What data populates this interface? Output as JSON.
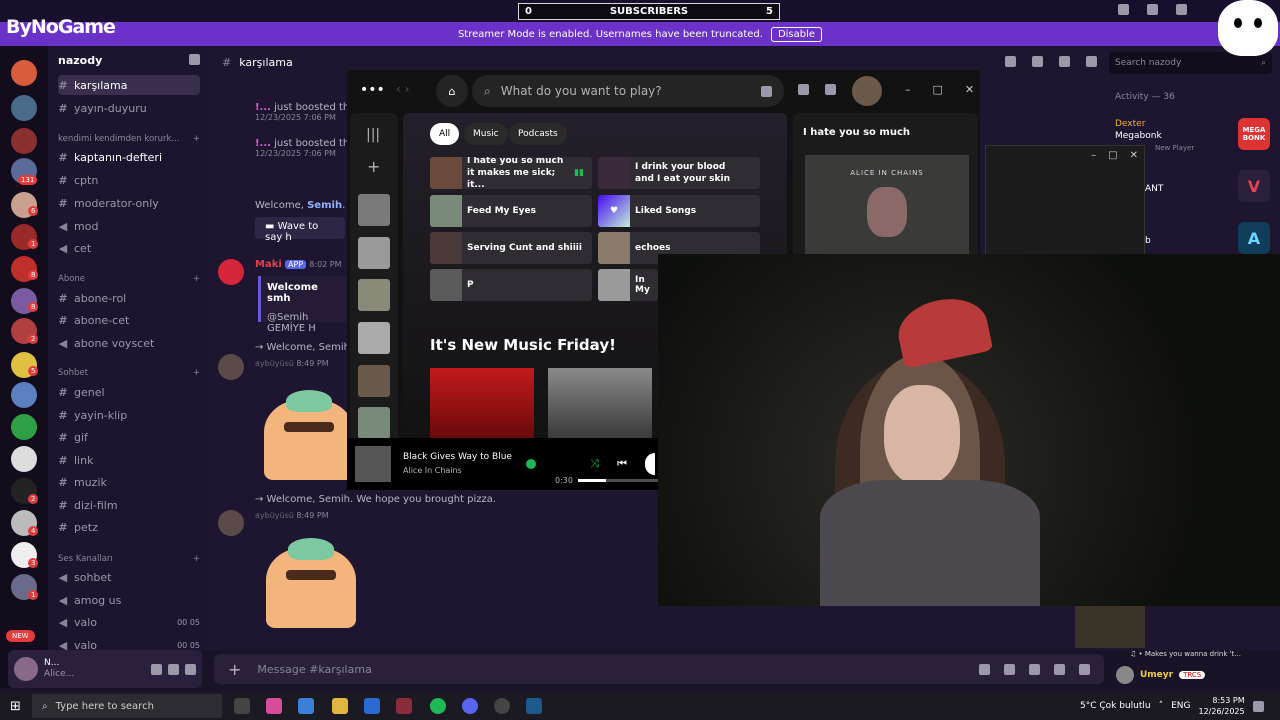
{
  "subs": {
    "left": "0",
    "label": "SUBSCRIBERS",
    "right": "5"
  },
  "banner": {
    "text": "Streamer Mode is enabled. Usernames have been truncated.",
    "button": "Disable"
  },
  "logo": "ByNoGame",
  "server": {
    "name": "nazody"
  },
  "channels": {
    "top": [
      {
        "label": "karşılama"
      },
      {
        "label": "yayın-duyuru"
      }
    ],
    "cat1": "kendimi kendimden korurk...",
    "list1": [
      {
        "label": "kaptanın-defteri"
      },
      {
        "label": "cptn"
      },
      {
        "label": "moderator-only"
      },
      {
        "label": "mod"
      },
      {
        "label": "cet"
      }
    ],
    "cat2": "Abone",
    "list2": [
      {
        "label": "abone-rol"
      },
      {
        "label": "abone-cet"
      },
      {
        "label": "abone voyscet"
      }
    ],
    "cat3": "Sohbet",
    "list3": [
      {
        "label": "genel"
      },
      {
        "label": "yayin-klip"
      },
      {
        "label": "gif"
      },
      {
        "label": "link"
      },
      {
        "label": "muzik"
      },
      {
        "label": "dizi-film"
      },
      {
        "label": "petz"
      }
    ],
    "cat4": "Ses Kanalları",
    "voice": [
      {
        "label": "sohbet"
      },
      {
        "label": "amog us"
      },
      {
        "label": "valo",
        "a": "00",
        "b": "05"
      },
      {
        "label": "valo",
        "a": "00",
        "b": "05"
      }
    ]
  },
  "user": {
    "name": "N...",
    "status": "Alice..."
  },
  "chat": {
    "channel": "karşılama",
    "m1": "just boosted the",
    "t1": "12/23/2025 7:06 PM",
    "m2": "just boosted the",
    "t2": "12/23/2025 7:06 PM",
    "welcome1a": "Welcome, ",
    "welcome1b": "Semih",
    "welcome1c": ". We",
    "wave": "Wave to say h",
    "maki": "Maki",
    "app": "APP",
    "maki_time": "8:02 PM",
    "embed_title": "Welcome smh",
    "embed_body": "@Semih GEMİYE H",
    "w2": "→ Welcome, Semih. We",
    "user2": "aybüyüsü",
    "time2": "8:49 PM",
    "w3": "→ Welcome, Semih. We hope you brought pizza.",
    "user3": "aybüyüsü",
    "time3": "8:49 PM",
    "placeholder": "Message #karşılama"
  },
  "spotify": {
    "search": "What do you want to play?",
    "chips": [
      "All",
      "Music",
      "Podcasts"
    ],
    "tiles": [
      {
        "l1": "I hate you so much",
        "l2": "it makes me sick; it..."
      },
      {
        "l1": "I drink your blood",
        "l2": "and I eat your skin"
      },
      {
        "l1": "Feed My Eyes",
        "l2": ""
      },
      {
        "l1": "Liked Songs",
        "l2": ""
      },
      {
        "l1": "Serving Cunt and shiiii",
        "l2": ""
      },
      {
        "l1": "echoes",
        "l2": ""
      },
      {
        "l1": "P",
        "l2": ""
      },
      {
        "l1": "In My",
        "l2": ""
      }
    ],
    "section": "It's New Music Friday!",
    "right_title": "I hate you so much",
    "right_art": "ALICE IN CHAINS",
    "now_title": "Black Gives Way to Blue",
    "now_artist": "Alice In Chains",
    "now_time": "0:30"
  },
  "right": {
    "search": "Search nazody",
    "activity": "Activity — 36",
    "a1": "Dexter",
    "a2": "Megabonk",
    "a3": "New Player",
    "a4": "ANT",
    "a5": "b",
    "gameicons": [
      {
        "label": "MEGA BONK",
        "color": "#d33"
      },
      {
        "label": "V",
        "color": "#e4424d"
      },
      {
        "label": "A",
        "color": "#0f3d5a"
      }
    ]
  },
  "stream": {
    "chatline": "♫ • Makes you wanna drink 't...",
    "chatuser": "Umeyr",
    "chatbadge": "TRCS"
  },
  "taskbar": {
    "search": "Type here to search",
    "weather": "5°C  Çok bulutlu",
    "lang": "ENG",
    "time": "8:53 PM",
    "date": "12/26/2025"
  },
  "badges": {
    "b131": "131",
    "b6": "6",
    "b1": "1",
    "b8": "8",
    "b5": "5",
    "b2": "2",
    "b4": "4",
    "b3": "3",
    "bnew": "NEW"
  }
}
